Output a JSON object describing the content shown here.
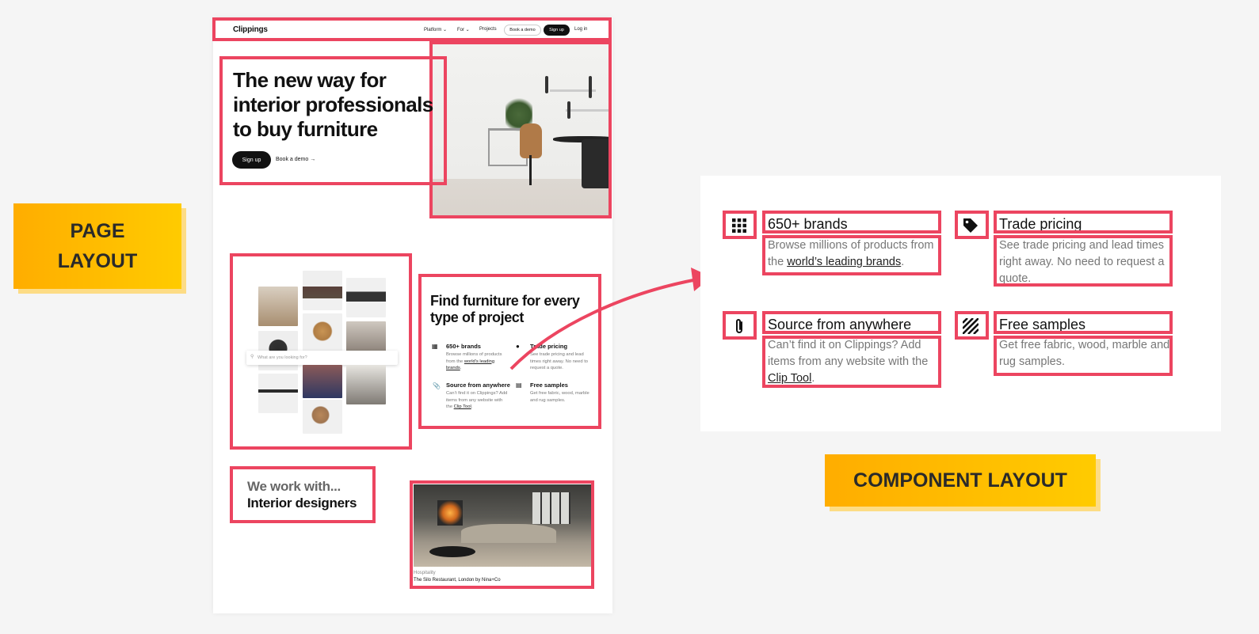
{
  "labels": {
    "page_layout_line1": "PAGE",
    "page_layout_line2": "LAYOUT",
    "component_layout": "COMPONENT LAYOUT"
  },
  "nav": {
    "logo": "Clippings",
    "platform": "Platform",
    "for": "For",
    "projects": "Projects",
    "book_demo": "Book a demo",
    "sign_up": "Sign up",
    "log_in": "Log in"
  },
  "hero": {
    "title": "The new way for interior professionals to buy furniture",
    "sign_up": "Sign up",
    "book_demo": "Book a demo →"
  },
  "search": {
    "placeholder": "What are you looking for?"
  },
  "features": {
    "title": "Find furniture for every type of project",
    "items": [
      {
        "icon": "grid-icon",
        "title": "650+ brands",
        "desc_before": "Browse millions of products from the ",
        "desc_link": "world’s leading brands",
        "desc_after": "."
      },
      {
        "icon": "tag-icon",
        "title": "Trade pricing",
        "desc_before": "See trade pricing and lead times right away. No need to request a quote.",
        "desc_link": "",
        "desc_after": ""
      },
      {
        "icon": "paperclip-icon",
        "title": "Source from anywhere",
        "desc_before": "Can’t find it on Clippings? Add items from any website with the ",
        "desc_link": "Clip Tool",
        "desc_after": "."
      },
      {
        "icon": "stripes-icon",
        "title": "Free samples",
        "desc_before": "Get free fabric, wood, marble and rug samples.",
        "desc_link": "",
        "desc_after": ""
      }
    ]
  },
  "we_work": {
    "line1": "We work with...",
    "line2": "Interior designers"
  },
  "case_study": {
    "category": "Hospitality",
    "caption": "The Silo Restaurant, London by Nina+Co"
  },
  "colors": {
    "highlight": "#ec4560",
    "tag_start": "#ffad00",
    "tag_end": "#ffcb00"
  }
}
